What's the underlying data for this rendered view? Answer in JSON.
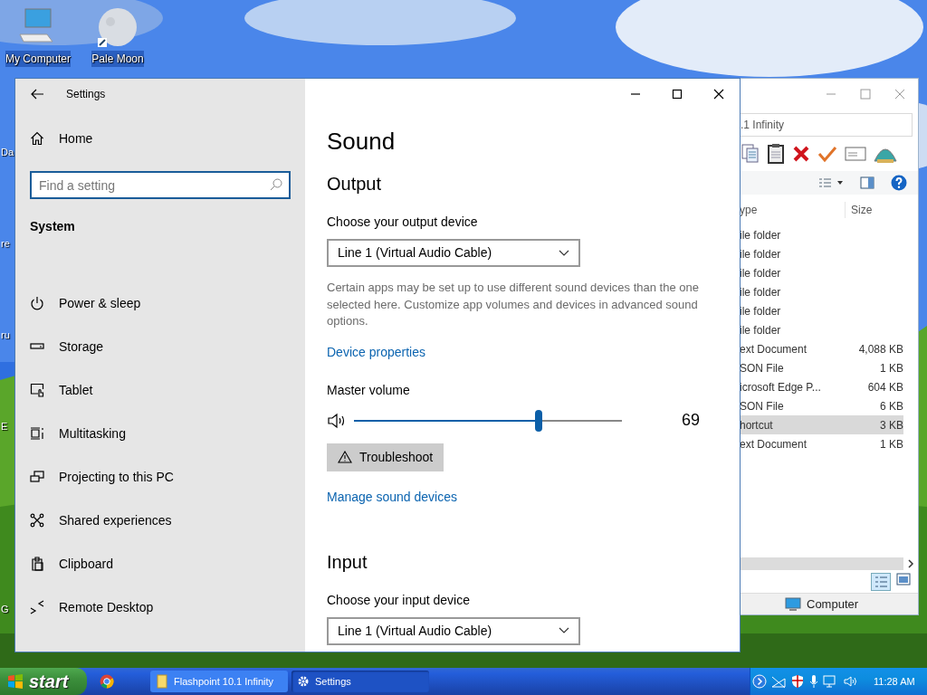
{
  "desktop": {
    "icons": [
      {
        "label": "My Computer"
      },
      {
        "label": "Pale Moon"
      }
    ],
    "edge_labels": [
      "Da",
      "re",
      "ru",
      "E",
      "G"
    ]
  },
  "explorer": {
    "address": ".1 Infinity",
    "columns": [
      "ype",
      "Size"
    ],
    "rows": [
      {
        "type": "ile folder",
        "selected": false
      },
      {
        "type": "ile folder",
        "selected": false
      },
      {
        "type": "ile folder",
        "selected": false
      },
      {
        "type": "ile folder",
        "selected": false
      },
      {
        "type": "ile folder",
        "selected": false
      },
      {
        "type": "ile folder",
        "selected": false
      },
      {
        "type": "ext Document",
        "size": "4,088 KB",
        "selected": false
      },
      {
        "type": "SON File",
        "size": "1 KB",
        "selected": false
      },
      {
        "type": "icrosoft Edge P...",
        "size": "604 KB",
        "selected": false
      },
      {
        "type": "SON File",
        "size": "6 KB",
        "selected": false
      },
      {
        "type": "hortcut",
        "size": "3 KB",
        "selected": true
      },
      {
        "type": "ext Document",
        "size": "1 KB",
        "selected": false
      }
    ],
    "status": "Computer"
  },
  "settings": {
    "title": "Settings",
    "home": "Home",
    "search": {
      "placeholder": "Find a setting"
    },
    "section": "System",
    "nav": [
      {
        "label": "Power & sleep"
      },
      {
        "label": "Storage"
      },
      {
        "label": "Tablet"
      },
      {
        "label": "Multitasking"
      },
      {
        "label": "Projecting to this PC"
      },
      {
        "label": "Shared experiences"
      },
      {
        "label": "Clipboard"
      },
      {
        "label": "Remote Desktop"
      }
    ],
    "page": {
      "title": "Sound",
      "output": {
        "heading": "Output",
        "device_label": "Choose your output device",
        "device": "Line 1 (Virtual Audio Cable)",
        "description": "Certain apps may be set up to use different sound devices than the one selected here. Customize app volumes and devices in advanced sound options.",
        "device_link": "Device properties",
        "volume_label": "Master volume",
        "volume": {
          "level": 0.69,
          "reading": "69"
        },
        "troubleshoot": "Troubleshoot",
        "manage_link": "Manage sound devices"
      },
      "input": {
        "heading": "Input",
        "device_label": "Choose your input device",
        "device": "Line 1 (Virtual Audio Cable)"
      }
    }
  },
  "taskbar": {
    "start": "start",
    "tasks": [
      {
        "label": "Flashpoint 10.1 Infinity",
        "selected": false
      },
      {
        "label": "Settings",
        "selected": true
      }
    ],
    "clock": "11:28 AM"
  }
}
